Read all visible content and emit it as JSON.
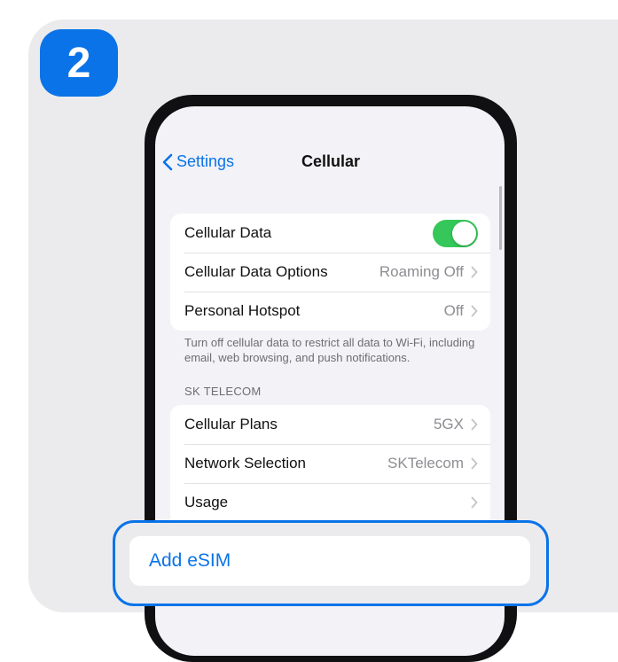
{
  "step_number": "2",
  "nav": {
    "back_label": "Settings",
    "title": "Cellular"
  },
  "group_data": [
    {
      "label": "Cellular Data",
      "type": "toggle",
      "on": true
    },
    {
      "label": "Cellular Data Options",
      "value": "Roaming Off"
    },
    {
      "label": "Personal Hotspot",
      "value": "Off"
    }
  ],
  "footnote": "Turn off cellular data to restrict all data to Wi-Fi, including email, web browsing, and push notifications.",
  "section_header": "SK TELECOM",
  "group_carrier": [
    {
      "label": "Cellular Plans",
      "value": "5GX"
    },
    {
      "label": "Network Selection",
      "value": "SKTelecom"
    },
    {
      "label": "Usage",
      "value": ""
    }
  ],
  "highlight": {
    "label": "Add eSIM"
  },
  "colors": {
    "accent": "#0a73e8",
    "toggle_on": "#35c759",
    "card_bg": "#ebebed"
  }
}
